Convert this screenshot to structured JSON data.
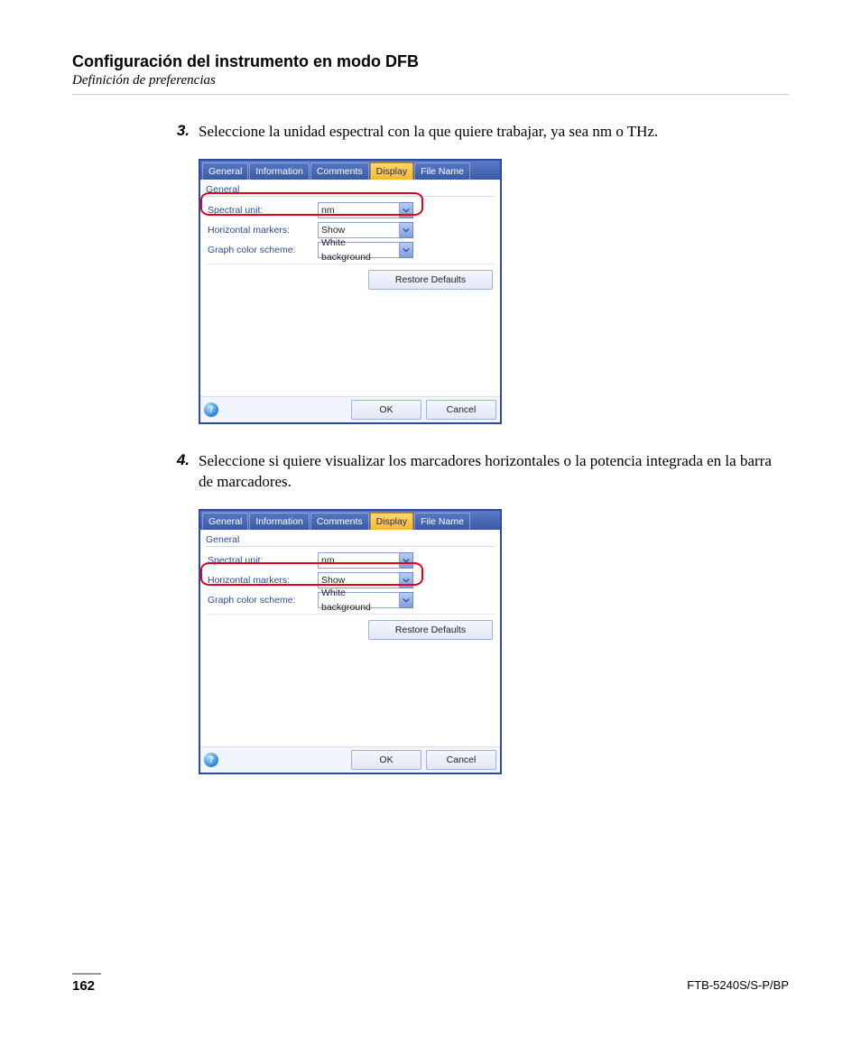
{
  "heading": "Configuración del instrumento en modo DFB",
  "subheading": "Definición de preferencias",
  "steps": [
    {
      "num": "3.",
      "text": "Seleccione la unidad espectral con la que quiere trabajar, ya sea nm o THz."
    },
    {
      "num": "4.",
      "text": "Seleccione si quiere visualizar los marcadores horizontales o la potencia integrada en la barra de marcadores."
    }
  ],
  "dialog": {
    "tabs": [
      "General",
      "Information",
      "Comments",
      "Display",
      "File Name"
    ],
    "active_tab": "Display",
    "group_label": "General",
    "rows": [
      {
        "label": "Spectral unit:",
        "value": "nm"
      },
      {
        "label": "Horizontal markers:",
        "value": "Show"
      },
      {
        "label": "Graph color scheme:",
        "value": "White background"
      }
    ],
    "buttons": {
      "restore": "Restore Defaults",
      "ok": "OK",
      "cancel": "Cancel",
      "help": "?"
    }
  },
  "footer": {
    "page_num": "162",
    "doc_id": "FTB-5240S/S-P/BP"
  }
}
